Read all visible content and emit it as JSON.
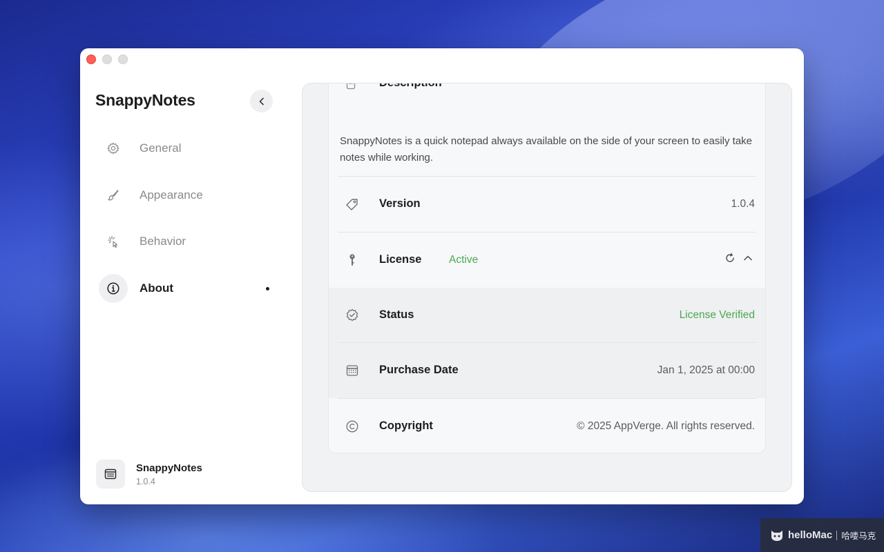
{
  "window": {
    "controls": [
      "close",
      "minimize",
      "maximize"
    ]
  },
  "sidebar": {
    "app_title": "SnappyNotes",
    "collapse_icon": "chevron-left-icon",
    "items": [
      {
        "label": "General",
        "icon": "gear-icon",
        "active": false
      },
      {
        "label": "Appearance",
        "icon": "paintbrush-icon",
        "active": false
      },
      {
        "label": "Behavior",
        "icon": "cursor-click-icon",
        "active": false
      },
      {
        "label": "About",
        "icon": "info-circle-icon",
        "active": true
      }
    ],
    "footer": {
      "name": "SnappyNotes",
      "version": "1.0.4",
      "icon": "note-app-icon"
    }
  },
  "about": {
    "description": {
      "label": "Description",
      "icon": "document-icon",
      "text": "SnappyNotes is a quick notepad always available on the side of your screen to easily take notes while working."
    },
    "rows": {
      "version": {
        "label": "Version",
        "value": "1.0.4",
        "icon": "tag-icon"
      },
      "license": {
        "label": "License",
        "status": "Active",
        "icon": "key-icon",
        "actions": [
          "refresh-icon",
          "chevron-up-icon"
        ]
      },
      "status": {
        "label": "Status",
        "value": "License Verified",
        "icon": "verified-badge-icon"
      },
      "purchase_date": {
        "label": "Purchase Date",
        "value": "Jan 1, 2025 at 00:00",
        "icon": "calendar-icon"
      },
      "copyright": {
        "label": "Copyright",
        "value": "© 2025 AppVerge. All rights reserved.",
        "icon": "copyright-icon"
      }
    }
  },
  "colors": {
    "accent_green": "#4aa84f",
    "close_red": "#fe5f57"
  },
  "watermark": {
    "brand": "helloMac",
    "chinese": "哈喽马克"
  }
}
